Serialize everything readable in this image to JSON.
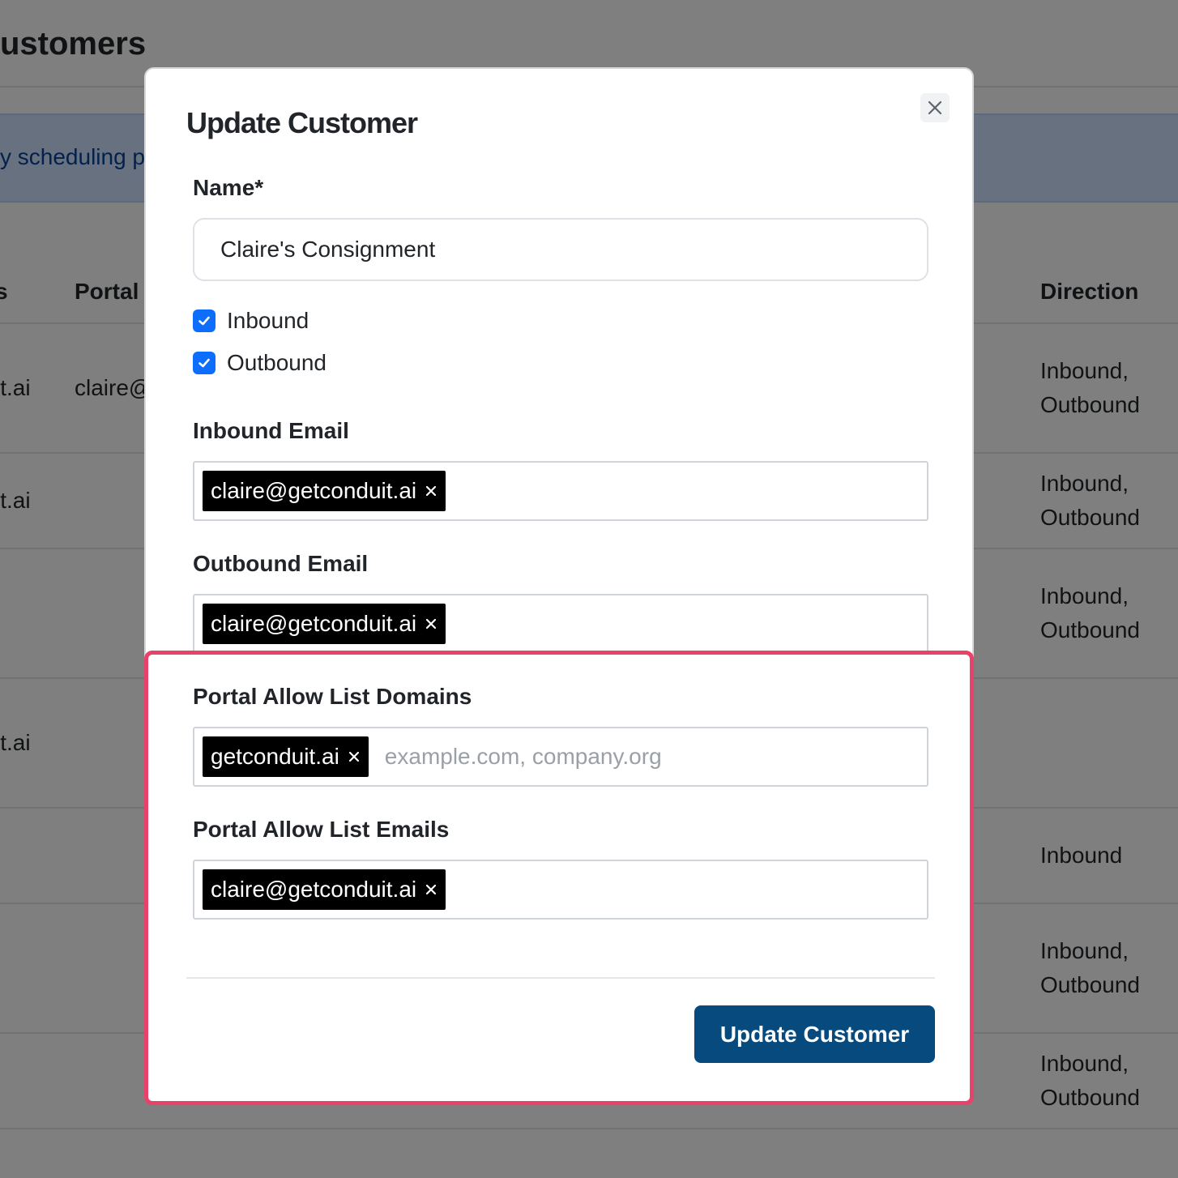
{
  "background": {
    "page_title": "ustomers",
    "alert_text": "y scheduling p",
    "table_headers": {
      "left_partial": "s",
      "portal": "Portal",
      "direction": "Direction"
    },
    "rows": [
      {
        "col1": "it.ai",
        "col2": "claire@",
        "direction_line1": "Inbound,",
        "direction_line2": "Outbound"
      },
      {
        "col1": "it.ai",
        "col2": "",
        "direction_line1": "Inbound,",
        "direction_line2": "Outbound"
      },
      {
        "col1": "",
        "col2": "",
        "direction_line1": "Inbound,",
        "direction_line2": "Outbound"
      },
      {
        "col1": "it.ai",
        "col2": "",
        "direction_line1": "",
        "direction_line2": ""
      },
      {
        "col1": "",
        "col2": "",
        "direction_line1": "Inbound",
        "direction_line2": ""
      },
      {
        "col1": "",
        "col2": "",
        "direction_line1": "Inbound,",
        "direction_line2": "Outbound"
      },
      {
        "col1": "",
        "col2": "",
        "direction_line1": "Inbound,",
        "direction_line2": "Outbound"
      }
    ]
  },
  "modal": {
    "title": "Update Customer",
    "name_label": "Name*",
    "name_value": "Claire's Consignment",
    "checkboxes": {
      "inbound": {
        "label": "Inbound",
        "checked": true
      },
      "outbound": {
        "label": "Outbound",
        "checked": true
      }
    },
    "inbound_email": {
      "label": "Inbound Email",
      "tags": [
        "claire@getconduit.ai"
      ]
    },
    "outbound_email": {
      "label": "Outbound Email",
      "tags": [
        "claire@getconduit.ai"
      ]
    },
    "portal_domains": {
      "label": "Portal Allow List Domains",
      "tags": [
        "getconduit.ai"
      ],
      "placeholder": "example.com, company.org"
    },
    "portal_emails": {
      "label": "Portal Allow List Emails",
      "tags": [
        "claire@getconduit.ai"
      ]
    },
    "submit_label": "Update Customer"
  },
  "colors": {
    "primary_button": "#064a7e",
    "checkbox": "#0d6efd",
    "tag_background": "#000000",
    "highlight_border": "#e8426a",
    "backdrop": "rgba(0,0,0,0.5)"
  },
  "icons": {
    "close": "close-icon",
    "tag_remove": "x-icon",
    "check": "checkmark-icon"
  }
}
